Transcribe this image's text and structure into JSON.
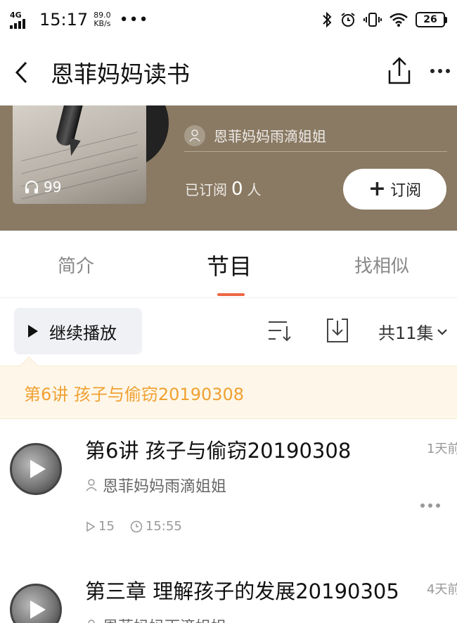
{
  "status_bar": {
    "network": "4G",
    "time": "15:17",
    "speed_value": "89.0",
    "speed_unit": "KB/s",
    "battery": "26"
  },
  "nav": {
    "title": "恩菲妈妈读书"
  },
  "header": {
    "play_count": "99",
    "author": "恩菲妈妈雨滴姐姐",
    "subscribed_prefix": "已订阅",
    "subscribed_count": "0",
    "subscribed_suffix": "人",
    "subscribe_label": "订阅",
    "background_color": "#8a7a63"
  },
  "tabs": [
    {
      "label": "简介",
      "active": false
    },
    {
      "label": "节目",
      "active": true
    },
    {
      "label": "找相似",
      "active": false
    }
  ],
  "toolbar": {
    "continue_label": "继续播放",
    "episode_count": "共11集"
  },
  "last_played": {
    "text": "第6讲 孩子与偷窃20190308",
    "color": "#f0a032"
  },
  "episodes": [
    {
      "title": "第6讲 孩子与偷窃20190308",
      "time_ago": "1天前",
      "author": "恩菲妈妈雨滴姐姐",
      "plays": "15",
      "duration": "15:55"
    },
    {
      "title": "第三章 理解孩子的发展20190305",
      "time_ago": "4天前",
      "author": "恩菲妈妈雨滴姐姐"
    }
  ],
  "accent_color": "#ef6644"
}
